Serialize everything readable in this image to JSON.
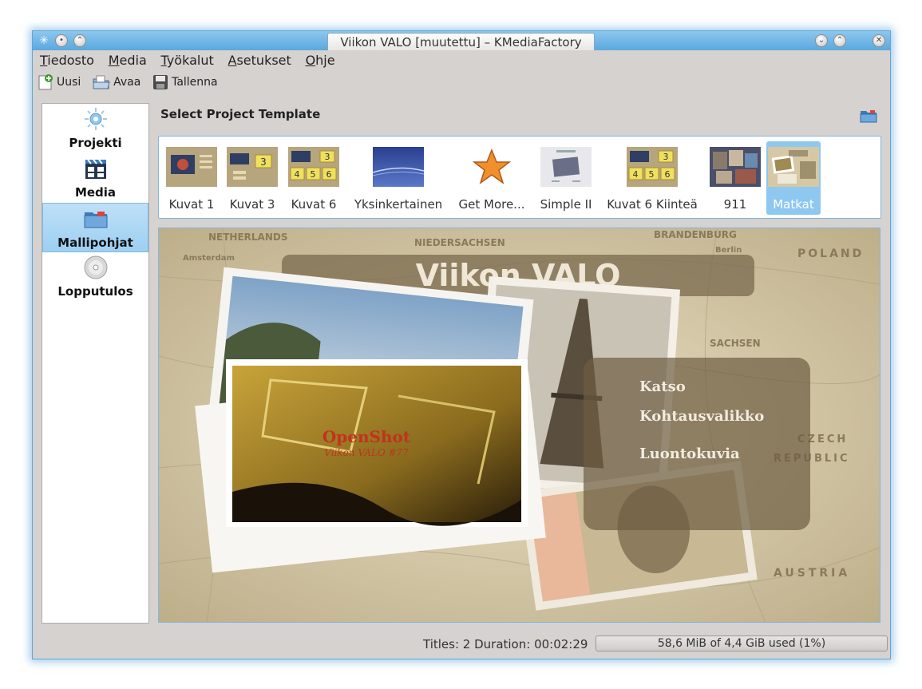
{
  "window": {
    "title": "Viikon VALO [muutettu] – KMediaFactory"
  },
  "menubar": {
    "items": [
      {
        "label": "Tiedosto",
        "accel": "T",
        "rest": "iedosto"
      },
      {
        "label": "Media",
        "accel": "M",
        "rest": "edia"
      },
      {
        "label": "Työkalut",
        "accel": "T",
        "rest": "yökalut"
      },
      {
        "label": "Asetukset",
        "accel": "A",
        "rest": "setukset"
      },
      {
        "label": "Ohje",
        "accel": "O",
        "rest": "hje"
      }
    ]
  },
  "toolbar": {
    "new_label": "Uusi",
    "open_label": "Avaa",
    "save_label": "Tallenna"
  },
  "sidebar": {
    "items": [
      {
        "label": "Projekti",
        "icon": "settings-icon",
        "selected": false
      },
      {
        "label": "Media",
        "icon": "media-icon",
        "selected": false
      },
      {
        "label": "Mallipohjat",
        "icon": "folder-icon",
        "selected": true
      },
      {
        "label": "Lopputulos",
        "icon": "disc-icon",
        "selected": false
      }
    ]
  },
  "heading": "Select Project Template",
  "templates": [
    {
      "label": "Kuvat 1"
    },
    {
      "label": "Kuvat 3"
    },
    {
      "label": "Kuvat 6"
    },
    {
      "label": "Yksinkertainen"
    },
    {
      "label": "Get More..."
    },
    {
      "label": "Simple II"
    },
    {
      "label": "Kuvat 6 Kiinteä"
    },
    {
      "label": "911"
    },
    {
      "label": "Matkat",
      "selected": true
    }
  ],
  "preview": {
    "title": "Viikon VALO",
    "menu_items": [
      "Katso",
      "Kohtausvalikko",
      "Luontokuvia"
    ],
    "overlay_title": "OpenShot",
    "overlay_subtitle": "Viikon VALO #77",
    "map_labels": [
      "NETHERLANDS",
      "NIEDERSACHSEN",
      "BRANDENBURG",
      "POLAND",
      "CZECH",
      "REPUBLIC",
      "AUSTRIA",
      "SACHSEN",
      "Berlin",
      "Amsterdam"
    ]
  },
  "status": {
    "text": "Titles: 2 Duration: 00:02:29",
    "usage": "58,6 MiB of 4,4 GiB used (1%)"
  },
  "colors": {
    "accent": "#8ec7f0",
    "titlebar": "#6eb5e6"
  }
}
